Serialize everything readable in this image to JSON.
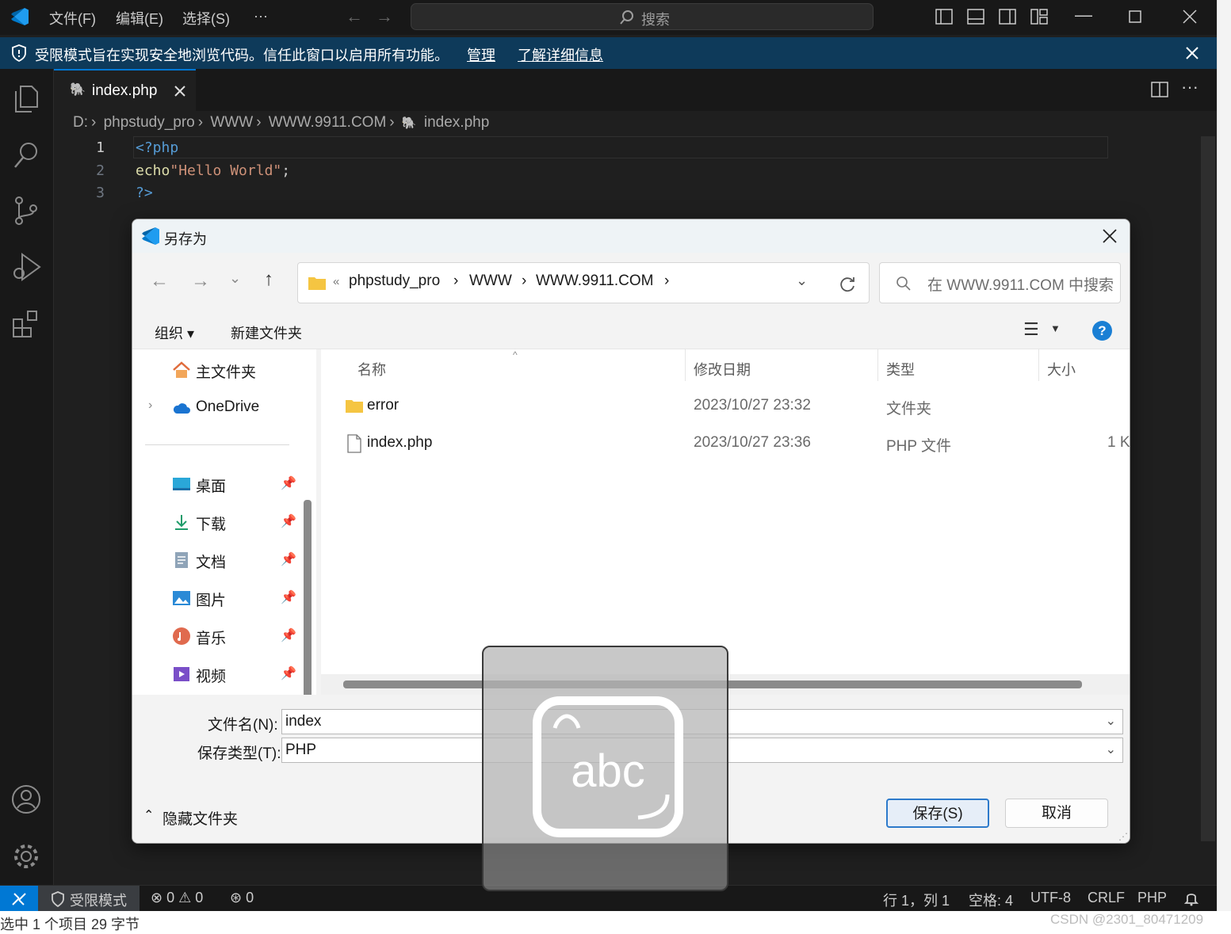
{
  "titlebar": {
    "menus": [
      "文件(F)",
      "编辑(E)",
      "选择(S)",
      "···"
    ],
    "search_placeholder": "搜索"
  },
  "banner": {
    "message": "受限模式旨在实现安全地浏览代码。信任此窗口以启用所有功能。",
    "manage_link": "管理",
    "learn_more_link": "了解详细信息"
  },
  "editor": {
    "tab_label": "index.php",
    "breadcrumb": [
      "D:",
      "phpstudy_pro",
      "WWW",
      "WWW.9911.COM",
      "index.php"
    ],
    "lines": [
      {
        "num": "1",
        "tokens": [
          {
            "t": "<?php",
            "c": "#569cd6"
          }
        ]
      },
      {
        "num": "2",
        "tokens": [
          {
            "t": "echo",
            "c": "#dcdcaa"
          },
          {
            "t": "\"Hello World\"",
            "c": "#ce9178"
          },
          {
            "t": ";",
            "c": "#cccccc"
          }
        ]
      },
      {
        "num": "3",
        "tokens": [
          {
            "t": "?>",
            "c": "#569cd6"
          }
        ]
      }
    ]
  },
  "statusbar": {
    "restricted": "受限模式",
    "errors": "0",
    "warnings": "0",
    "ports": "0",
    "position": "行 1，列 1",
    "spaces": "空格: 4",
    "encoding": "UTF-8",
    "eol": "CRLF",
    "language": "PHP"
  },
  "explorer_status": "选中 1 个项目  29 字节",
  "watermark": "CSDN @2301_80471209",
  "dialog": {
    "title": "另存为",
    "address": [
      "phpstudy_pro",
      "WWW",
      "WWW.9911.COM"
    ],
    "address_prefix": "«",
    "search_placeholder": "在 WWW.9911.COM 中搜索",
    "toolbar": {
      "organize": "组织 ▾",
      "new_folder": "新建文件夹"
    },
    "nav_items": [
      {
        "label": "主文件夹",
        "icon": "home-icon",
        "pinned": false
      },
      {
        "label": "OneDrive",
        "icon": "cloud-icon",
        "pinned": false
      },
      {
        "label": "桌面",
        "icon": "desktop-icon",
        "pinned": true
      },
      {
        "label": "下载",
        "icon": "download-icon",
        "pinned": true
      },
      {
        "label": "文档",
        "icon": "document-icon",
        "pinned": true
      },
      {
        "label": "图片",
        "icon": "picture-icon",
        "pinned": true
      },
      {
        "label": "音乐",
        "icon": "music-icon",
        "pinned": true
      },
      {
        "label": "视频",
        "icon": "video-icon",
        "pinned": true
      }
    ],
    "columns": {
      "name": "名称",
      "modified": "修改日期",
      "type": "类型",
      "size": "大小"
    },
    "files": [
      {
        "name": "error",
        "modified": "2023/10/27 23:32",
        "type": "文件夹",
        "size": "",
        "icon": "folder-icon"
      },
      {
        "name": "index.php",
        "modified": "2023/10/27 23:36",
        "type": "PHP 文件",
        "size": "1 K",
        "icon": "file-icon"
      }
    ],
    "filename_label": "文件名(N):",
    "filename_value": "index",
    "filetype_label": "保存类型(T):",
    "filetype_value": "PHP",
    "hide_folders": "隐藏文件夹",
    "save_button": "保存(S)",
    "cancel_button": "取消"
  },
  "ime_overlay": {
    "text": "abc"
  },
  "colors": {
    "accent": "#0078d4",
    "banner": "#0e3a5a",
    "editor_bg": "#1f1f1f"
  }
}
